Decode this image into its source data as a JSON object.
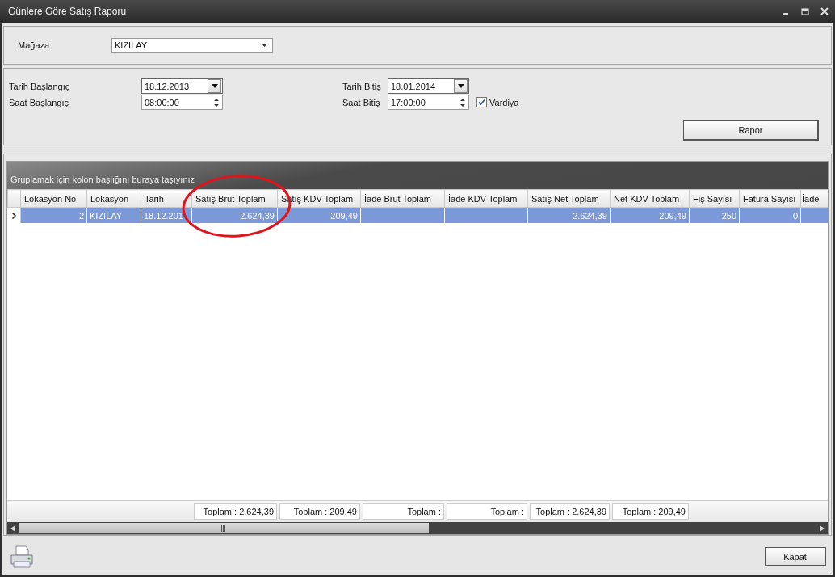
{
  "window": {
    "title": "Günlere Göre Satış Raporu"
  },
  "store": {
    "label": "Mağaza",
    "value": "KIZILAY"
  },
  "filters": [
    {
      "label": "Tarih Başlangıç",
      "value": "18.12.2013",
      "kind": "date"
    },
    {
      "label": "Tarih Bitiş",
      "value": "18.01.2014",
      "kind": "date"
    },
    {
      "label": "Saat Başlangıç",
      "value": "08:00:00",
      "kind": "time"
    },
    {
      "label": "Saat Bitiş",
      "value": "17:00:00",
      "kind": "time"
    }
  ],
  "shift": {
    "label": "Vardiya",
    "checked": true
  },
  "report_button": "Rapor",
  "grid": {
    "group_hint": "Gruplamak için kolon başlığını buraya taşıyınız",
    "columns": [
      {
        "label": "Lokasyon No",
        "kind": "number"
      },
      {
        "label": "Lokasyon",
        "kind": "text"
      },
      {
        "label": "Tarih",
        "kind": "text"
      },
      {
        "label": "Satış Brüt Toplam",
        "kind": "number"
      },
      {
        "label": "Satış KDV Toplam",
        "kind": "number"
      },
      {
        "label": "İade Brüt Toplam",
        "kind": "number"
      },
      {
        "label": "İade KDV Toplam",
        "kind": "number"
      },
      {
        "label": "Satış Net Toplam",
        "kind": "number"
      },
      {
        "label": "Net KDV Toplam",
        "kind": "number"
      },
      {
        "label": "Fiş Sayısı",
        "kind": "number"
      },
      {
        "label": "Fatura Sayısı",
        "kind": "number"
      },
      {
        "label": "İade",
        "kind": "number"
      }
    ],
    "rows": [
      {
        "selected": true,
        "cells": [
          {
            "text": "2"
          },
          {
            "text": "KIZILAY"
          },
          {
            "text": "18.12.201"
          },
          {
            "text": "2.624,39"
          },
          {
            "text": "209,49"
          },
          {},
          {},
          {
            "text": "2.624,39"
          },
          {
            "text": "209,49"
          },
          {
            "text": "250"
          },
          {
            "text": "0"
          },
          {}
        ]
      }
    ],
    "totals": [
      "Toplam : 2.624,39",
      "Toplam : 209,49",
      "Toplam :",
      "Toplam :",
      "Toplam : 2.624,39",
      "Toplam : 209,49"
    ]
  },
  "close_button": "Kapat"
}
